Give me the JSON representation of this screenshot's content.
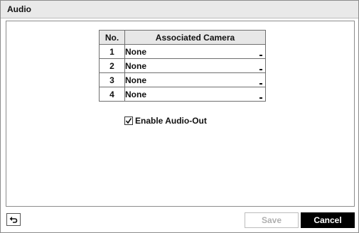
{
  "window": {
    "title": "Audio"
  },
  "table": {
    "headers": {
      "no": "No.",
      "camera": "Associated Camera"
    },
    "rows": [
      {
        "no": "1",
        "camera": "None"
      },
      {
        "no": "2",
        "camera": "None"
      },
      {
        "no": "3",
        "camera": "None"
      },
      {
        "no": "4",
        "camera": "None"
      }
    ]
  },
  "enable_audio_out": {
    "label": "Enable Audio-Out",
    "checked": true
  },
  "footer": {
    "back_icon": "return-arrow-icon",
    "save_label": "Save",
    "save_enabled": false,
    "cancel_label": "Cancel"
  }
}
